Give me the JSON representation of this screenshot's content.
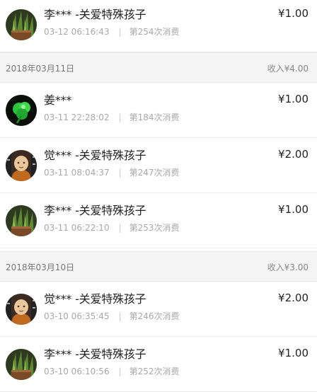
{
  "entries": [
    {
      "type": "tx",
      "avatar": "plant-photo-avatar",
      "name": "李*** -关爱特殊孩子",
      "time": "03-12 06:16:43",
      "count": "第254次消费",
      "amount": "¥1.00"
    },
    {
      "type": "header",
      "date": "2018年03月11日",
      "income": "收入¥4.00"
    },
    {
      "type": "tx",
      "avatar": "green-clover-avatar",
      "name": "姜***",
      "time": "03-11 22:28:02",
      "count": "第184次消费",
      "amount": "¥1.00"
    },
    {
      "type": "tx",
      "avatar": "buddha-figure-avatar",
      "name": "觉*** -关爱特殊孩子",
      "time": "03-11 08:04:37",
      "count": "第247次消费",
      "amount": "¥2.00"
    },
    {
      "type": "tx",
      "avatar": "plant-photo-avatar",
      "name": "李*** -关爱特殊孩子",
      "time": "03-11 06:22:10",
      "count": "第253次消费",
      "amount": "¥1.00"
    },
    {
      "type": "header",
      "date": "2018年03月10日",
      "income": "收入¥3.00"
    },
    {
      "type": "tx",
      "avatar": "buddha-figure-avatar",
      "name": "觉*** -关爱特殊孩子",
      "time": "03-10 06:35:45",
      "count": "第246次消费",
      "amount": "¥2.00"
    },
    {
      "type": "tx",
      "avatar": "plant-photo-avatar",
      "name": "李*** -关爱特殊孩子",
      "time": "03-10 06:10:56",
      "count": "第252次消费",
      "amount": "¥1.00"
    }
  ],
  "meta_separator": "|"
}
